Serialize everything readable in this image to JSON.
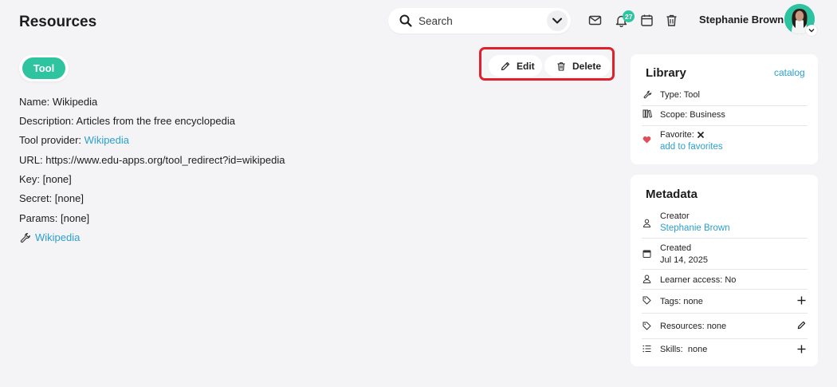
{
  "header": {
    "title": "Resources",
    "search": {
      "placeholder": "Search"
    },
    "notifications": {
      "count": "27"
    },
    "user": {
      "name": "Stephanie Brown"
    }
  },
  "resource": {
    "type_tag": "Tool",
    "actions": {
      "edit_label": "Edit",
      "delete_label": "Delete"
    },
    "details": {
      "name": "Name: Wikipedia",
      "description": "Description: Articles from the free encyclopedia",
      "provider_label": "Tool provider: ",
      "provider_link": "Wikipedia",
      "url": "URL: https://www.edu-apps.org/tool_redirect?id=wikipedia",
      "key": "Key: [none]",
      "secret": "Secret: [none]",
      "params": "Params: [none]",
      "launch_link": "Wikipedia"
    }
  },
  "library": {
    "title": "Library",
    "catalog_link": "catalog",
    "type": "Type: Tool",
    "scope": "Scope: Business",
    "favorite_label": "Favorite:",
    "add_favorites": "add to favorites"
  },
  "metadata": {
    "title": "Metadata",
    "creator_label": "Creator",
    "creator_name": "Stephanie Brown",
    "created_label": "Created",
    "created_date": "Jul 14, 2025",
    "learner_access": "Learner access: No",
    "tags": "Tags: none",
    "resources": "Resources: none",
    "skills": "Skills:  none"
  },
  "colors": {
    "accent": "#2fc4a0",
    "link": "#2b9fd0",
    "highlight_border": "#e0202a",
    "favorite": "#e0505a"
  }
}
